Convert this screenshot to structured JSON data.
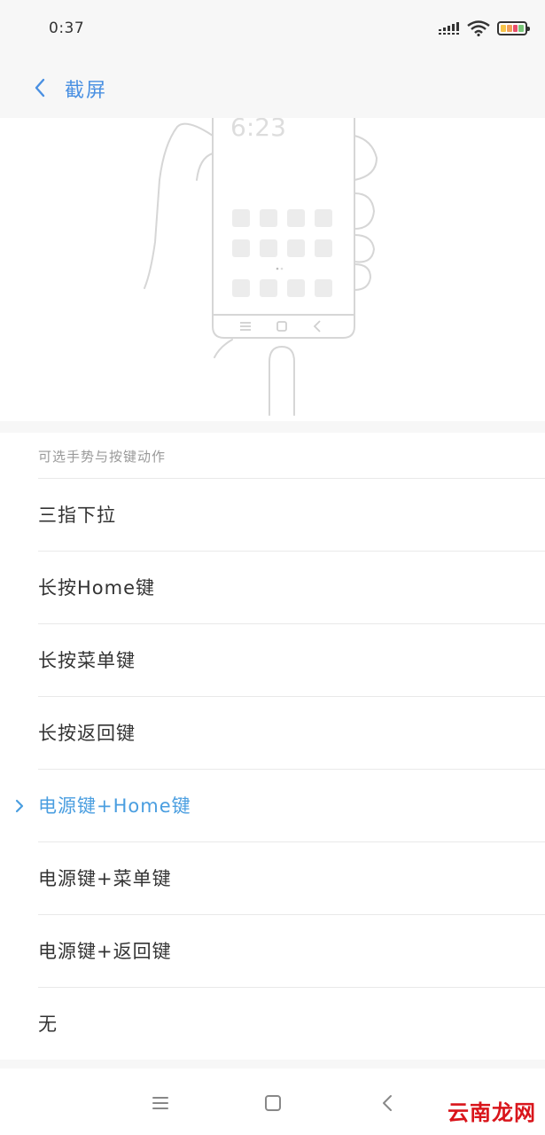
{
  "status_bar": {
    "time": "0:37",
    "icons": [
      "signal-icon",
      "wifi-icon",
      "battery-icon"
    ]
  },
  "header": {
    "back_icon": "chevron-left-icon",
    "title": "截屏"
  },
  "illustration": {
    "phone_time": "6:23"
  },
  "list": {
    "section_title": "可选手势与按键动作",
    "items": [
      {
        "label": "三指下拉",
        "selected": false
      },
      {
        "label": "长按Home键",
        "selected": false
      },
      {
        "label": "长按菜单键",
        "selected": false
      },
      {
        "label": "长按返回键",
        "selected": false
      },
      {
        "label": "电源键+Home键",
        "selected": true
      },
      {
        "label": "电源键+菜单键",
        "selected": false
      },
      {
        "label": "电源键+返回键",
        "selected": false
      },
      {
        "label": "无",
        "selected": false
      }
    ]
  },
  "nav_bar": {
    "icons": [
      "menu-icon",
      "home-icon",
      "back-icon"
    ]
  },
  "watermark": "云南龙网",
  "colors": {
    "accent": "#4a90e2",
    "selected_text": "#4a9ee0",
    "background": "#f7f7f7"
  }
}
